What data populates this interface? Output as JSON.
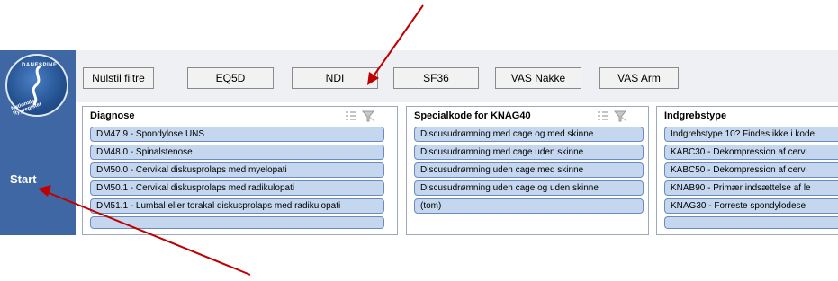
{
  "sidebar": {
    "logo_top_text": "DANESPINE",
    "logo_bottom_text": "Nationale Rygregister",
    "start_label": "Start"
  },
  "toolbar": {
    "buttons": [
      "Nulstil filtre",
      "EQ5D",
      "NDI",
      "SF36",
      "VAS Nakke",
      "VAS Arm"
    ]
  },
  "panels": {
    "diagnose": {
      "title": "Diagnose",
      "items": [
        "DM47.9 - Spondylose UNS",
        "DM48.0 - Spinalstenose",
        "DM50.0 - Cervikal diskusprolaps med myelopati",
        "DM50.1 - Cervikal diskusprolaps med radikulopati",
        "DM51.1 - Lumbal eller torakal diskusprolaps med radikulopati"
      ]
    },
    "specialkode": {
      "title": "Specialkode for KNAG40",
      "items": [
        "Discusudrømning med cage og med skinne",
        "Discusudrømning med cage uden skinne",
        "Discusudrømning uden cage med skinne",
        "Discusudrømning uden cage og uden skinne",
        "(tom)"
      ]
    },
    "indgreb": {
      "title": "Indgrebstype",
      "items": [
        "Indgrebstype 10? Findes ikke i kode",
        "KABC30 - Dekompression af cervi",
        "KABC50 - Dekompression af cervi",
        "KNAB90 - Primær indsættelse af le",
        "KNAG30 - Forreste spondylodese"
      ]
    }
  },
  "colors": {
    "sidebar": "#3f67a4",
    "item_fill": "#c4d7ee",
    "item_border": "#6b8bbd",
    "arrow": "#c00000"
  }
}
